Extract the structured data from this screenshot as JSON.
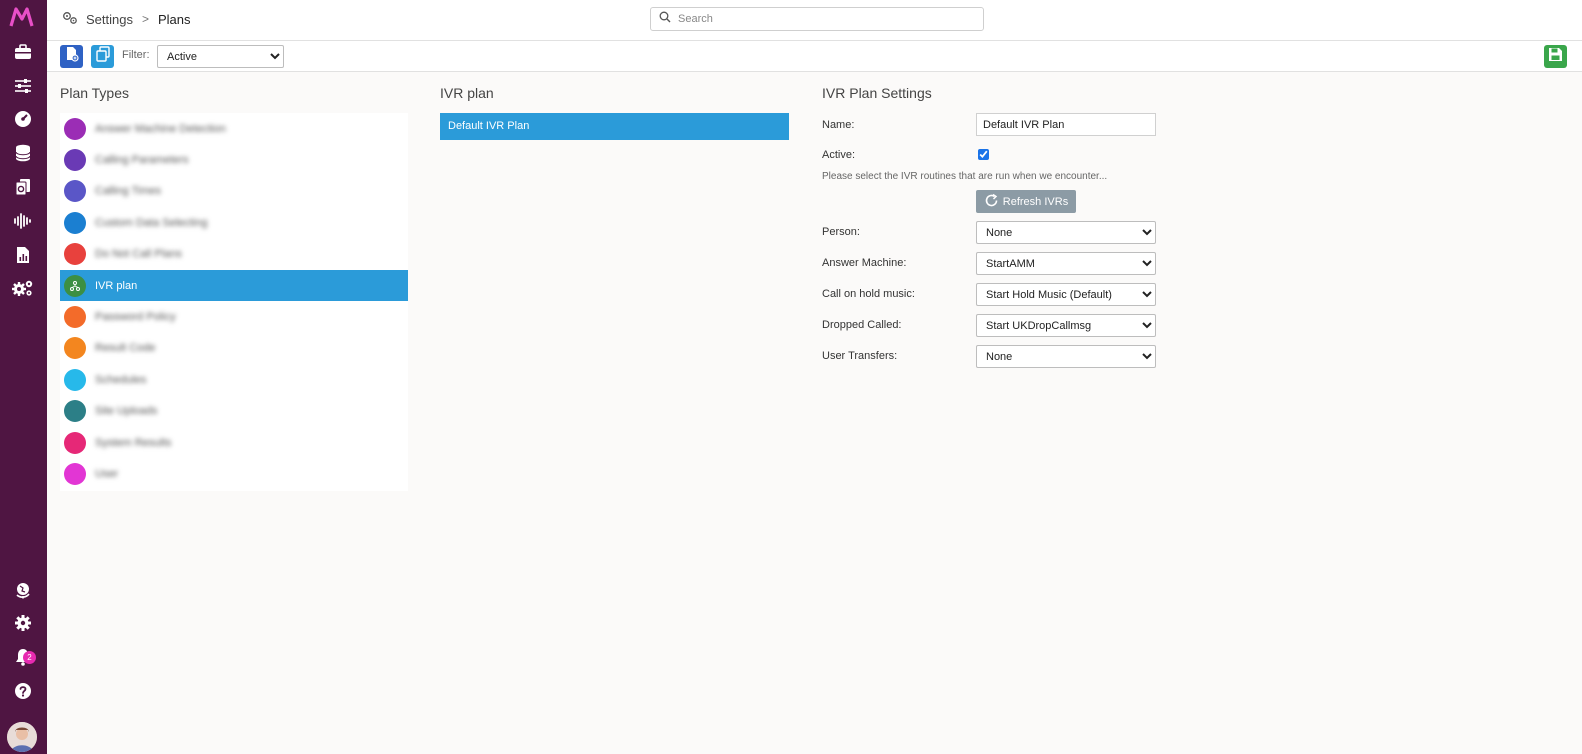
{
  "breadcrumb": {
    "root": "Settings",
    "separator": ">",
    "current": "Plans"
  },
  "search": {
    "placeholder": "Search"
  },
  "toolbar": {
    "filter_label": "Filter:",
    "filter_value": "Active"
  },
  "plan_types": {
    "title": "Plan Types",
    "items": [
      {
        "label": "Answer Machine Detection",
        "color": "#9b2db5",
        "blurred": true
      },
      {
        "label": "Calling Parameters",
        "color": "#6a3ab5",
        "blurred": true
      },
      {
        "label": "Calling Times",
        "color": "#5a56c7",
        "blurred": true
      },
      {
        "label": "Custom Data Selecting",
        "color": "#1b7fd1",
        "blurred": true
      },
      {
        "label": "Do Not Call Plans",
        "color": "#e8413d",
        "blurred": true
      },
      {
        "label": "IVR plan",
        "color": "#3c8f43",
        "blurred": false,
        "selected": true
      },
      {
        "label": "Password Policy",
        "color": "#f36b2a",
        "blurred": true
      },
      {
        "label": "Result Code",
        "color": "#f3861f",
        "blurred": true
      },
      {
        "label": "Schedules",
        "color": "#27b9ea",
        "blurred": true
      },
      {
        "label": "Site Uploads",
        "color": "#2c7f87",
        "blurred": true
      },
      {
        "label": "System Results",
        "color": "#e62877",
        "blurred": true
      },
      {
        "label": "User",
        "color": "#e236d4",
        "blurred": true
      }
    ]
  },
  "ivr_plan": {
    "title": "IVR plan",
    "items": [
      "Default IVR Plan"
    ]
  },
  "settings": {
    "title": "IVR Plan Settings",
    "name_label": "Name:",
    "name_value": "Default IVR Plan",
    "active_label": "Active:",
    "active_checked": true,
    "hint": "Please select the IVR routines that are run when we encounter...",
    "refresh_label": "Refresh IVRs",
    "fields": [
      {
        "label": "Person:",
        "value": "None"
      },
      {
        "label": "Answer Machine:",
        "value": "StartAMM"
      },
      {
        "label": "Call on hold music:",
        "value": "Start Hold Music (Default)"
      },
      {
        "label": "Dropped Called:",
        "value": "Start UKDropCallmsg"
      },
      {
        "label": "User Transfers:",
        "value": "None"
      }
    ]
  },
  "notifications": {
    "count": "2"
  },
  "colors": {
    "rail": "#4f1542",
    "accent": "#2b9bd9",
    "save": "#3aa64b",
    "new": "#2f62c4",
    "copy": "#2b9bd9"
  },
  "icons": [
    "logo-icon",
    "briefcase-icon",
    "sliders-icon",
    "dashboard-icon",
    "database-icon",
    "files-icon",
    "audio-wave-icon",
    "report-icon",
    "cogs-icon",
    "globe-icon",
    "settings-icon",
    "bell-icon",
    "help-icon"
  ]
}
